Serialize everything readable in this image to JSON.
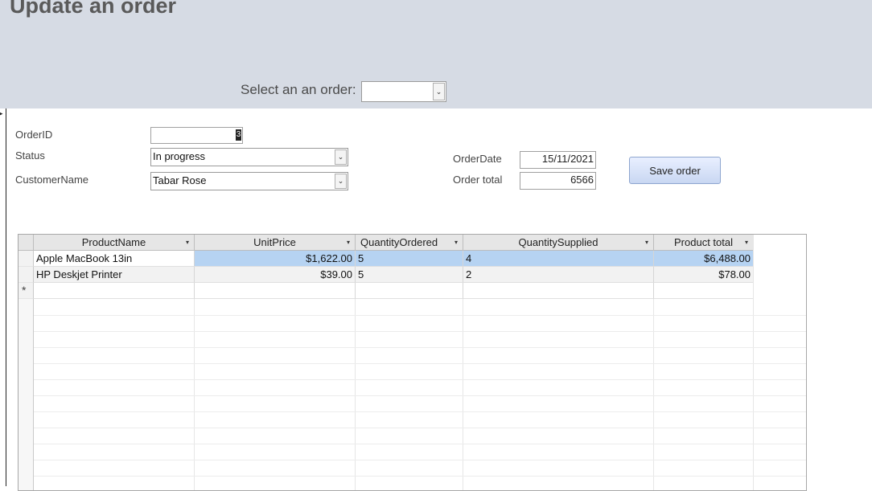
{
  "header": {
    "title": "Update an order",
    "select_label": "Select an an order:",
    "select_value": ""
  },
  "form": {
    "order_id_label": "OrderID",
    "order_id_value": "3",
    "status_label": "Status",
    "status_value": "In progress",
    "customer_label": "CustomerName",
    "customer_value": "Tabar Rose",
    "order_date_label": "OrderDate",
    "order_date_value": "15/11/2021",
    "order_total_label": "Order total",
    "order_total_value": "6566",
    "save_label": "Save order"
  },
  "table": {
    "columns": [
      "ProductName",
      "UnitPrice",
      "QuantityOrdered",
      "QuantitySupplied",
      "Product total"
    ],
    "rows": [
      [
        "Apple MacBook  13in",
        "$1,622.00",
        "5",
        "4",
        "$6,488.00"
      ],
      [
        "HP Deskjet Printer",
        "$39.00",
        "5",
        "2",
        "$78.00"
      ]
    ],
    "new_row_marker": "*"
  }
}
